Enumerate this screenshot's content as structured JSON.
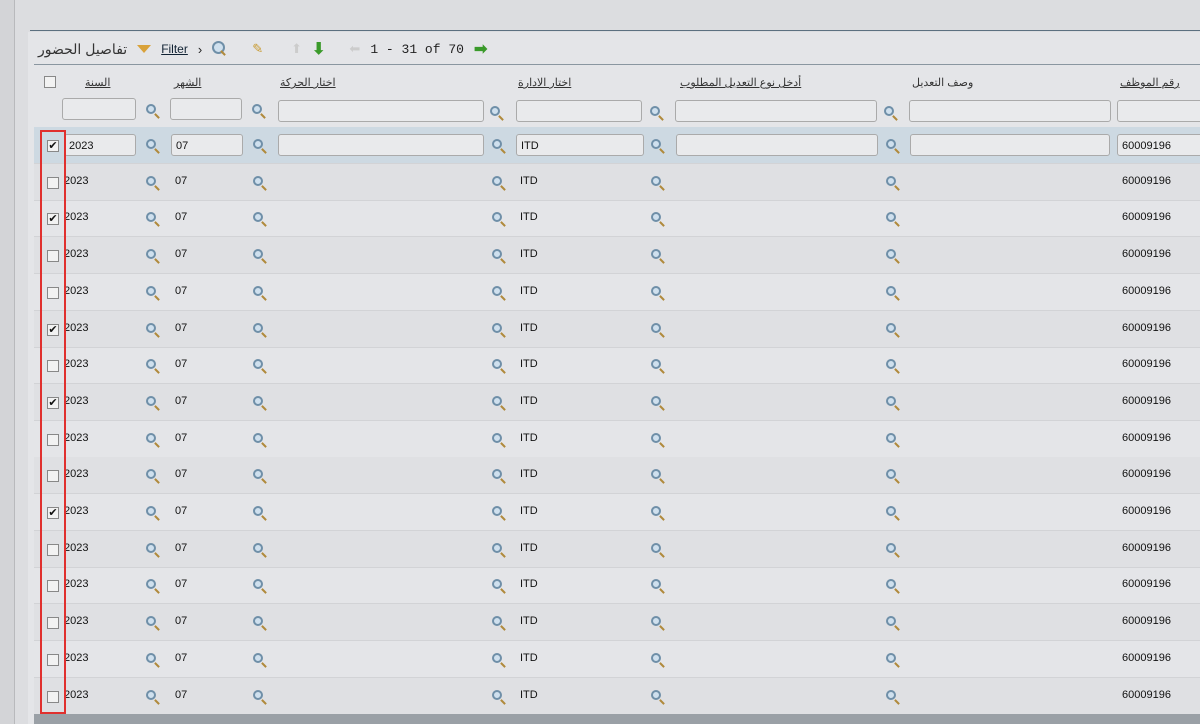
{
  "toolbar": {
    "title": "تفاصيل الحضور",
    "filter_label": "Filter",
    "pager": "1 - 31 of 70"
  },
  "columns": [
    "السنة",
    "الشهر",
    "اختار الحركة",
    "اختار الادارة",
    "أدخل نوع التعديل المطلوب",
    "وصف التعديل",
    "رقم الموظف"
  ],
  "rows": [
    {
      "checked": true,
      "year": "2023",
      "month": "07",
      "dept": "ITD",
      "emp": "60009196"
    },
    {
      "checked": false,
      "year": "2023",
      "month": "07",
      "dept": "ITD",
      "emp": "60009196"
    },
    {
      "checked": true,
      "year": "2023",
      "month": "07",
      "dept": "ITD",
      "emp": "60009196"
    },
    {
      "checked": false,
      "year": "2023",
      "month": "07",
      "dept": "ITD",
      "emp": "60009196"
    },
    {
      "checked": false,
      "year": "2023",
      "month": "07",
      "dept": "ITD",
      "emp": "60009196"
    },
    {
      "checked": true,
      "year": "2023",
      "month": "07",
      "dept": "ITD",
      "emp": "60009196"
    },
    {
      "checked": false,
      "year": "2023",
      "month": "07",
      "dept": "ITD",
      "emp": "60009196"
    },
    {
      "checked": true,
      "year": "2023",
      "month": "07",
      "dept": "ITD",
      "emp": "60009196"
    },
    {
      "checked": false,
      "year": "2023",
      "month": "07",
      "dept": "ITD",
      "emp": "60009196"
    },
    {
      "checked": false,
      "year": "2023",
      "month": "07",
      "dept": "ITD",
      "emp": "60009196"
    },
    {
      "checked": true,
      "year": "2023",
      "month": "07",
      "dept": "ITD",
      "emp": "60009196"
    },
    {
      "checked": false,
      "year": "2023",
      "month": "07",
      "dept": "ITD",
      "emp": "60009196"
    },
    {
      "checked": false,
      "year": "2023",
      "month": "07",
      "dept": "ITD",
      "emp": "60009196"
    },
    {
      "checked": false,
      "year": "2023",
      "month": "07",
      "dept": "ITD",
      "emp": "60009196"
    },
    {
      "checked": false,
      "year": "2023",
      "month": "07",
      "dept": "ITD",
      "emp": "60009196"
    },
    {
      "checked": false,
      "year": "2023",
      "month": "07",
      "dept": "ITD",
      "emp": "60009196"
    }
  ],
  "colors": {
    "highlight": "#e0302e",
    "accent_arrow": "#3a9a2a"
  }
}
